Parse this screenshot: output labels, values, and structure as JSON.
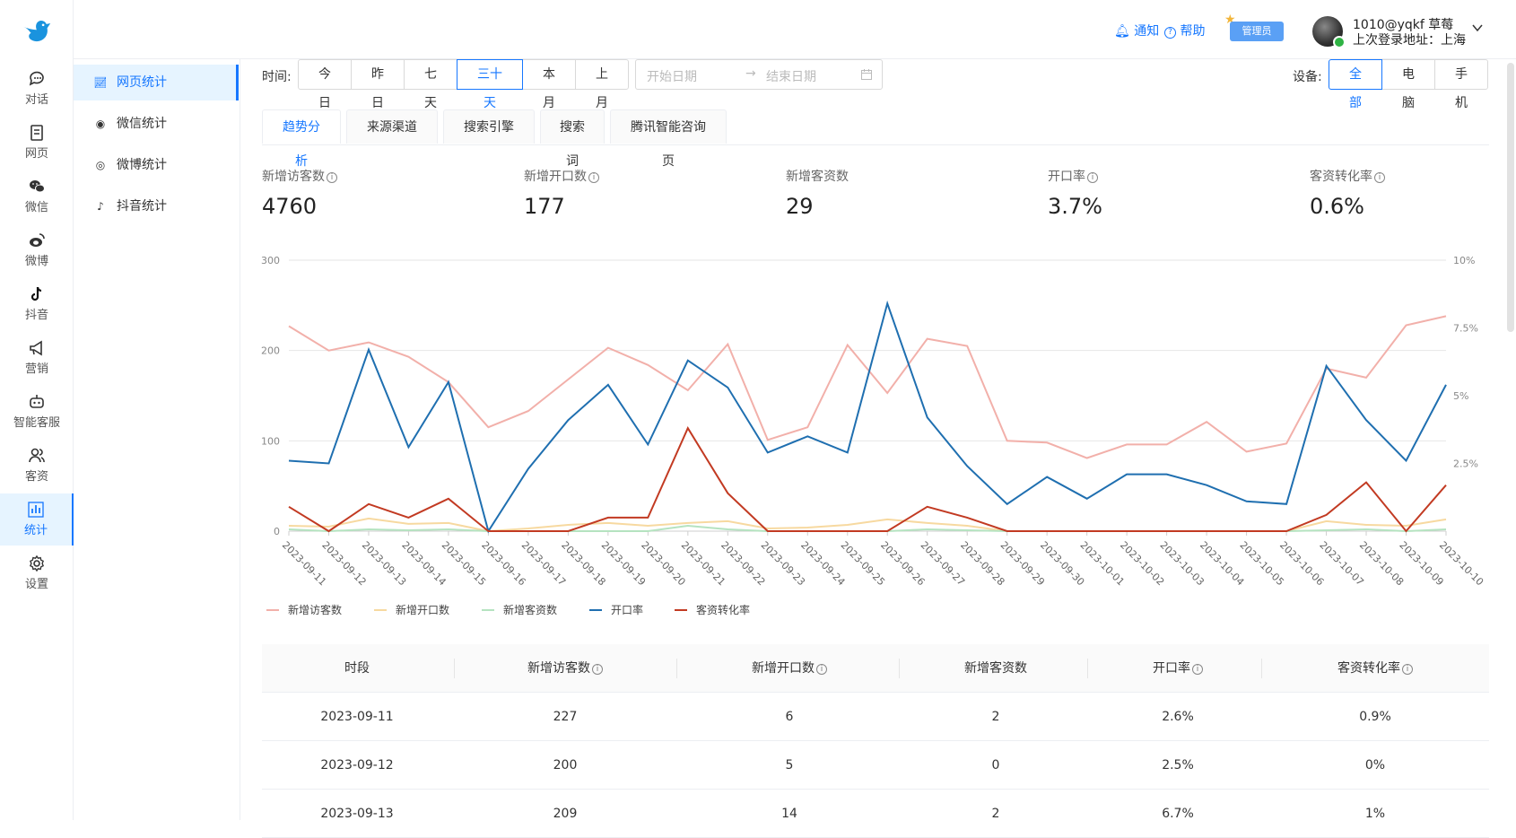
{
  "nav": {
    "items": [
      {
        "label": "对话",
        "icon": "chat-icon"
      },
      {
        "label": "网页",
        "icon": "page-icon"
      },
      {
        "label": "微信",
        "icon": "wechat-icon"
      },
      {
        "label": "微博",
        "icon": "weibo-icon"
      },
      {
        "label": "抖音",
        "icon": "tiktok-icon"
      },
      {
        "label": "营销",
        "icon": "megaphone-icon"
      },
      {
        "label": "智能客服",
        "icon": "robot-icon"
      },
      {
        "label": "客资",
        "icon": "users-icon"
      },
      {
        "label": "统计",
        "icon": "stats-icon",
        "active": true
      },
      {
        "label": "设置",
        "icon": "gear-icon"
      }
    ]
  },
  "submenu": {
    "items": [
      {
        "label": "网页统计",
        "icon": "line-chart-icon",
        "active": true
      },
      {
        "label": "微信统计",
        "icon": "wechat-icon"
      },
      {
        "label": "微博统计",
        "icon": "weibo-icon"
      },
      {
        "label": "抖音统计",
        "icon": "tiktok-icon"
      }
    ]
  },
  "header": {
    "notify": "通知",
    "help": "帮助",
    "admin_badge": "管理员",
    "user_name": "1010@yqkf 草莓",
    "last_login": "上次登录地址：上海"
  },
  "filters": {
    "time_label": "时间:",
    "time_options": [
      "今日",
      "昨日",
      "七天",
      "三十天",
      "本月",
      "上月"
    ],
    "time_selected": "三十天",
    "start_placeholder": "开始日期",
    "end_placeholder": "结束日期",
    "device_label": "设备:",
    "device_options": [
      "全部",
      "电脑",
      "手机"
    ],
    "device_selected": "全部"
  },
  "tabs": [
    "趋势分析",
    "来源渠道",
    "搜索引擎",
    "搜索词",
    "腾讯智能咨询页"
  ],
  "tab_selected": "趋势分析",
  "kpis": [
    {
      "label": "新增访客数",
      "value": "4760",
      "info": true
    },
    {
      "label": "新增开口数",
      "value": "177",
      "info": true
    },
    {
      "label": "新增客资数",
      "value": "29",
      "info": false
    },
    {
      "label": "开口率",
      "value": "3.7%",
      "info": true
    },
    {
      "label": "客资转化率",
      "value": "0.6%",
      "info": true
    }
  ],
  "chart_data": {
    "type": "line",
    "x": [
      "2023-09-11",
      "2023-09-12",
      "2023-09-13",
      "2023-09-14",
      "2023-09-15",
      "2023-09-16",
      "2023-09-17",
      "2023-09-18",
      "2023-09-19",
      "2023-09-20",
      "2023-09-21",
      "2023-09-22",
      "2023-09-23",
      "2023-09-24",
      "2023-09-25",
      "2023-09-26",
      "2023-09-27",
      "2023-09-28",
      "2023-09-29",
      "2023-09-30",
      "2023-10-01",
      "2023-10-02",
      "2023-10-03",
      "2023-10-04",
      "2023-10-05",
      "2023-10-06",
      "2023-10-07",
      "2023-10-08",
      "2023-10-09",
      "2023-10-10"
    ],
    "y_left_ticks": [
      "0",
      "100",
      "200",
      "300"
    ],
    "y_right_ticks": [
      "",
      "2.5%",
      "5%",
      "7.5%",
      "10%"
    ],
    "ylim_left": [
      0,
      300
    ],
    "ylim_right": [
      0,
      10
    ],
    "grid": true,
    "legend_position": "bottom-left",
    "series": [
      {
        "name": "新增访客数",
        "axis": "left",
        "color": "#f2b0aa",
        "values": [
          227,
          200,
          209,
          193,
          165,
          115,
          133,
          168,
          203,
          184,
          156,
          207,
          101,
          115,
          206,
          153,
          213,
          205,
          100,
          98,
          81,
          96,
          96,
          121,
          88,
          97,
          180,
          170,
          228,
          238
        ]
      },
      {
        "name": "新增开口数",
        "axis": "left",
        "color": "#f7d9a0",
        "values": [
          6,
          5,
          14,
          8,
          9,
          0,
          3,
          7,
          9,
          6,
          9,
          11,
          3,
          4,
          7,
          13,
          9,
          6,
          0,
          0,
          0,
          0,
          0,
          0,
          0,
          0,
          11,
          7,
          6,
          13
        ]
      },
      {
        "name": "新增客资数",
        "axis": "left",
        "color": "#b5e3c0",
        "values": [
          2,
          0,
          2,
          1,
          2,
          0,
          0,
          0,
          0,
          0,
          6,
          2,
          0,
          0,
          0,
          0,
          2,
          1,
          0,
          0,
          0,
          0,
          0,
          0,
          0,
          0,
          1,
          2,
          0,
          2
        ]
      },
      {
        "name": "开口率",
        "axis": "right",
        "color": "#1f6fb0",
        "values": [
          2.6,
          2.5,
          6.7,
          3.1,
          5.5,
          0,
          2.3,
          4.1,
          5.4,
          3.2,
          6.3,
          5.3,
          2.9,
          3.5,
          2.9,
          8.4,
          4.2,
          2.4,
          1.0,
          2.0,
          1.2,
          2.1,
          2.1,
          1.7,
          1.1,
          1.0,
          6.1,
          4.1,
          2.6,
          5.4
        ]
      },
      {
        "name": "客资转化率",
        "axis": "right",
        "color": "#c23a22",
        "values": [
          0.9,
          0,
          1,
          0.5,
          1.2,
          0,
          0,
          0,
          0.5,
          0.5,
          3.8,
          1.4,
          0,
          0,
          0,
          0,
          0.9,
          0.5,
          0,
          0,
          0,
          0,
          0,
          0,
          0,
          0,
          0.6,
          1.8,
          0,
          1.7
        ]
      }
    ]
  },
  "table": {
    "headers": [
      {
        "label": "时段",
        "info": false
      },
      {
        "label": "新增访客数",
        "info": true
      },
      {
        "label": "新增开口数",
        "info": true
      },
      {
        "label": "新增客资数",
        "info": false
      },
      {
        "label": "开口率",
        "info": true
      },
      {
        "label": "客资转化率",
        "info": true
      }
    ],
    "rows": [
      [
        "2023-09-11",
        "227",
        "6",
        "2",
        "2.6%",
        "0.9%"
      ],
      [
        "2023-09-12",
        "200",
        "5",
        "0",
        "2.5%",
        "0%"
      ],
      [
        "2023-09-13",
        "209",
        "14",
        "2",
        "6.7%",
        "1%"
      ]
    ]
  }
}
